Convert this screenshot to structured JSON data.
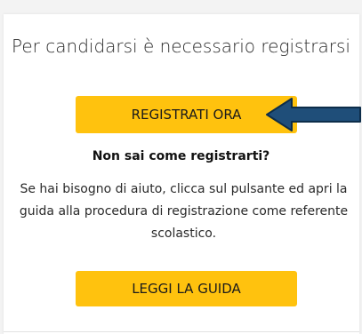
{
  "card": {
    "title": "Per candidarsi è necessario registrarsi",
    "register_button_label": "REGISTRATI ORA",
    "help_heading": "Non sai come registrarti?",
    "help_text": "Se hai bisogno di aiuto, clicca sul pulsante ed apri la guida alla procedura di registrazione come referente scolastico.",
    "guide_button_label": "LEGGI LA GUIDA"
  },
  "annotation": {
    "icon": "arrow-left-icon",
    "color": "#1f4e79"
  },
  "colors": {
    "button_bg": "#ffc20e",
    "page_bg": "#f3f3f3",
    "card_bg": "#ffffff"
  }
}
